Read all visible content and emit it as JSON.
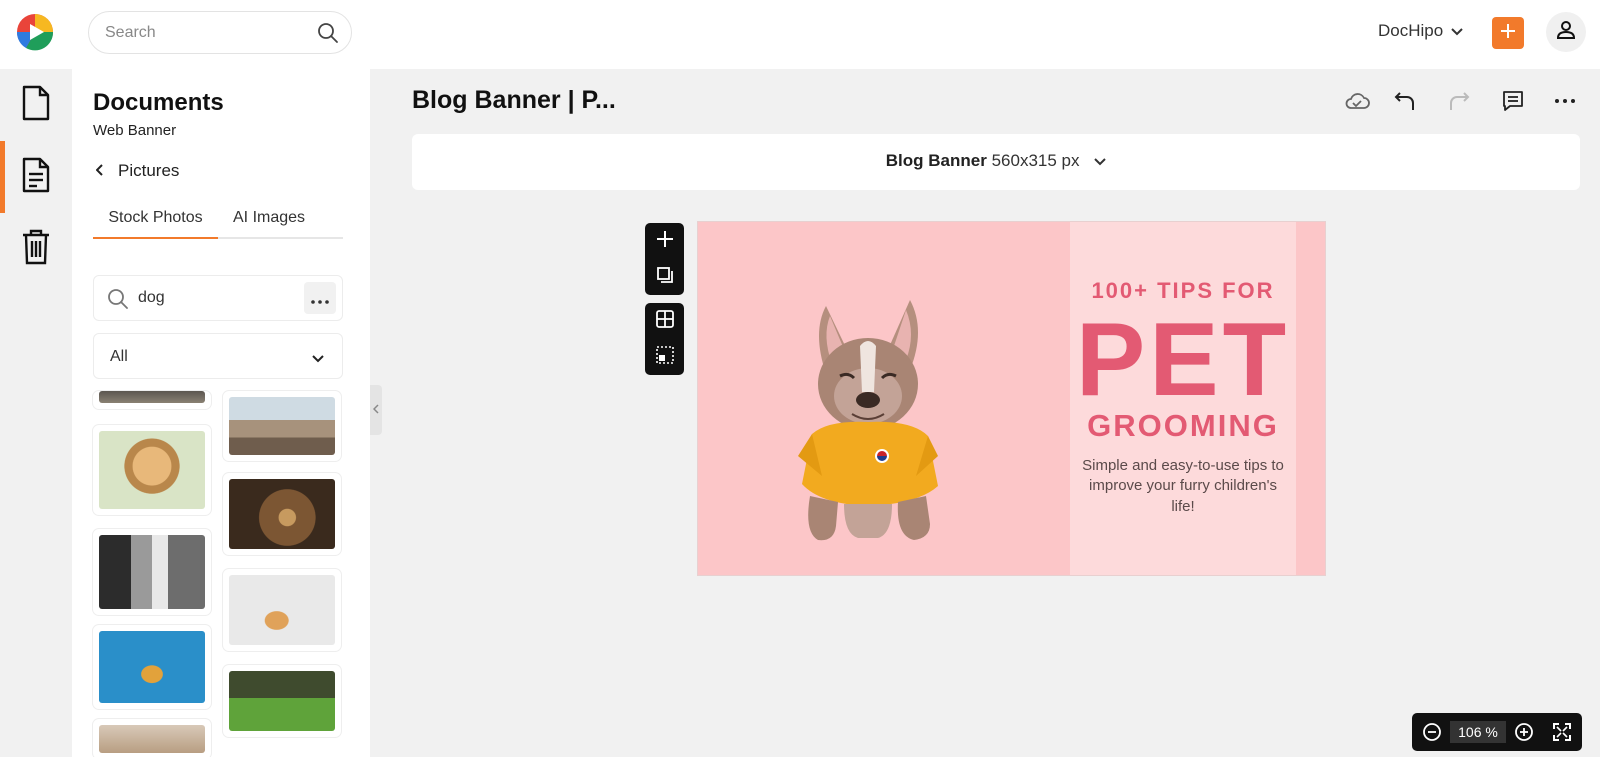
{
  "header": {
    "search_placeholder": "Search",
    "account_name": "DocHipo",
    "accent_color": "#f27a2b"
  },
  "rail": {
    "items": [
      {
        "icon": "document-icon"
      },
      {
        "icon": "document-lines-icon",
        "active": true
      },
      {
        "icon": "trash-icon"
      }
    ]
  },
  "panel": {
    "title": "Documents",
    "subtitle": "Web Banner",
    "back_label": "Pictures",
    "tabs": [
      {
        "label": "Stock Photos",
        "active": true
      },
      {
        "label": "AI Images",
        "active": false
      }
    ],
    "search_value": "dog",
    "filter_value": "All"
  },
  "editor": {
    "doc_title": "Blog Banner | P...",
    "size_name": "Blog Banner",
    "size_dims": "560x315 px"
  },
  "banner": {
    "tips": "100+ TIPS FOR",
    "headline": "PET",
    "subheadline": "GROOMING",
    "description": "Simple and easy-to-use tips to improve your furry children's life!"
  },
  "zoom": {
    "level": "106 %"
  }
}
